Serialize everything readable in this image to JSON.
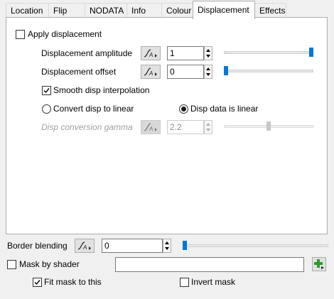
{
  "tabs": [
    {
      "label": "Location",
      "active": false
    },
    {
      "label": "Flip",
      "active": false
    },
    {
      "label": "NODATA",
      "active": false
    },
    {
      "label": "Info",
      "active": false
    },
    {
      "label": "Colour",
      "active": false
    },
    {
      "label": "Displacement",
      "active": true
    },
    {
      "label": "Effects",
      "active": false
    }
  ],
  "displacement": {
    "apply_label": "Apply displacement",
    "apply_checked": false,
    "amplitude_label": "Displacement amplitude",
    "amplitude_value": "1",
    "amplitude_slider": 1.0,
    "offset_label": "Displacement offset",
    "offset_value": "0",
    "offset_slider": 0.0,
    "smooth_label": "Smooth disp interpolation",
    "smooth_checked": true,
    "convert_linear_label": "Convert disp to linear",
    "convert_linear_selected": false,
    "data_linear_label": "Disp data is linear",
    "data_linear_selected": true,
    "gamma_label": "Disp conversion gamma",
    "gamma_value": "2.2",
    "gamma_slider": 0.5
  },
  "footer": {
    "border_blending_label": "Border blending",
    "border_blending_value": "0",
    "border_blending_slider": 0.0,
    "mask_by_shader_label": "Mask by shader",
    "mask_by_shader_checked": false,
    "mask_shader_value": "",
    "fit_mask_label": "Fit mask to this",
    "fit_mask_checked": true,
    "invert_mask_label": "Invert mask",
    "invert_mask_checked": false
  },
  "icons": {
    "curve": "curve-editor-icon",
    "add": "add-plus-icon",
    "check": "checkmark-icon"
  },
  "colors": {
    "slider_thumb": "#0078d7",
    "add_icon": "#2e9b2e",
    "disabled_text": "#a0a0a0"
  }
}
